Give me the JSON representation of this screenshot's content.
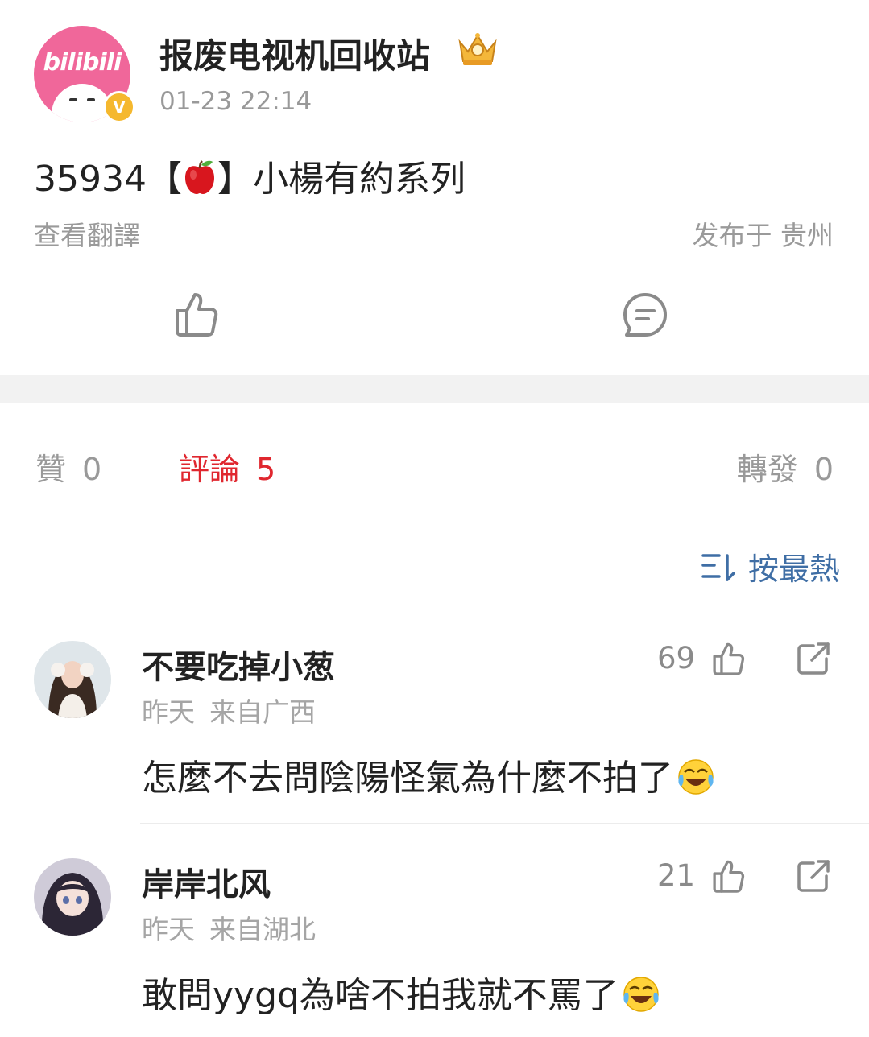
{
  "post": {
    "avatar_logo": "bilibili",
    "verified_badge": "V",
    "author": "报废电视机回收站",
    "author_badge_icon": "crown-icon",
    "time": "01-23 22:14",
    "content_prefix": "35934【",
    "content_emoji": "apple-icon",
    "content_suffix": "】小楊有約系列",
    "translate_label": "查看翻譯",
    "location": "发布于 贵州"
  },
  "tabs": {
    "likes_label": "贊",
    "likes_count": "0",
    "comments_label": "評論",
    "comments_count": "5",
    "reposts_label": "轉發",
    "reposts_count": "0"
  },
  "sort": {
    "label": "按最熱",
    "icon": "sort-icon"
  },
  "comments": [
    {
      "name": "不要吃掉小葱",
      "time": "昨天",
      "location": "来自广西",
      "likes": "69",
      "text": "怎麼不去問陰陽怪氣為什麼不拍了",
      "emoji": "laugh-cry-emoji"
    },
    {
      "name": "岸岸北风",
      "time": "昨天",
      "location": "来自湖北",
      "likes": "21",
      "text": "敢問yygq為啥不拍我就不罵了",
      "emoji": "laugh-cry-emoji"
    }
  ],
  "colors": {
    "accent_red": "#e0272f",
    "link_blue": "#3f6ea5",
    "bilibili_pink": "#f0679a",
    "muted_text": "#999999"
  }
}
